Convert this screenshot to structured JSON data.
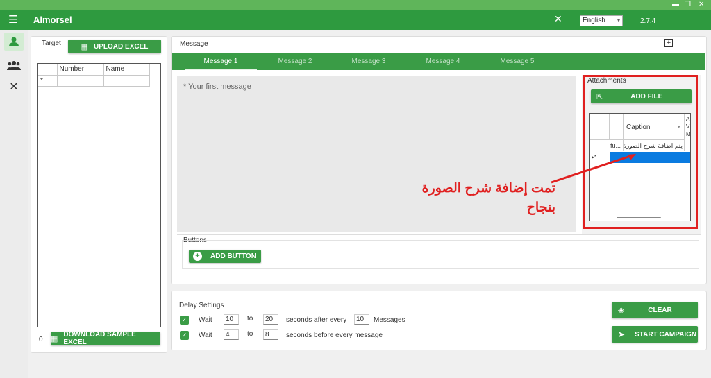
{
  "window": {
    "minimize": "▬",
    "restore": "❐",
    "close": "✕"
  },
  "app": {
    "title": "Almorsel",
    "language": "English",
    "version": "2.7.4"
  },
  "icons": {
    "menu": "menu-icon",
    "tools": "tools-icon",
    "user": "user-icon",
    "group": "group-icon",
    "settings": "settings-icon",
    "excel": "excel-icon"
  },
  "target": {
    "label": "Target",
    "upload_label": "UPLOAD EXCEL",
    "columns": [
      "Number",
      "Name"
    ],
    "new_row_marker": "*",
    "count": "0",
    "download_label": "DOWNLOAD SAMPLE EXCEL"
  },
  "message": {
    "label": "Message",
    "tabs": [
      "Message 1",
      "Message 2",
      "Message 3",
      "Message 4",
      "Message 5"
    ],
    "placeholder": "* Your first message"
  },
  "attachments": {
    "label": "Attachments",
    "add_file_label": "ADD FILE",
    "columns": [
      "Caption",
      "A V M"
    ],
    "row_file": "fu...",
    "row_caption": "يتم اضافة شرح الصورة هنا",
    "new_row_marker": "▸*"
  },
  "annotation": {
    "line1": "تمت إضافة شرح الصورة",
    "line2": "بنجاح",
    "color": "#e02020"
  },
  "buttons_section": {
    "label": "Buttons",
    "add_button_label": "ADD BUTTON"
  },
  "delay": {
    "label": "Delay Settings",
    "row1": {
      "wait": "Wait",
      "from": "10",
      "to_word": "to",
      "to": "20",
      "text": "seconds after every",
      "every": "10",
      "unit": "Messages"
    },
    "row2": {
      "wait": "Wait",
      "from": "4",
      "to_word": "to",
      "to": "8",
      "text": "seconds before every message"
    }
  },
  "actions": {
    "clear_label": "CLEAR",
    "start_label": "START CAMPAIGN"
  },
  "colors": {
    "primary": "#2e9a3f",
    "titlebar": "#5fb55a",
    "tabbar": "#3a9c46"
  }
}
